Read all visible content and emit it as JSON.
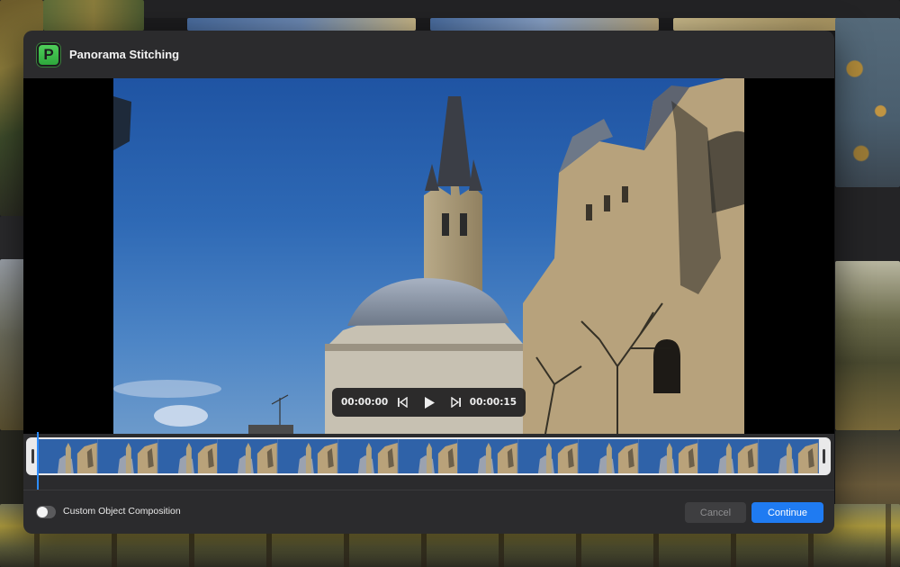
{
  "dialog": {
    "title": "Panorama Stitching",
    "app_icon_letter": "P",
    "accent_color": "#1f7bf2",
    "icon_color": "#3fbf4c"
  },
  "player": {
    "current_time": "00:00:00",
    "total_time": "00:00:15",
    "icons": [
      "skip-back-icon",
      "play-icon",
      "skip-forward-icon"
    ]
  },
  "filmstrip": {
    "frame_count": 13,
    "playhead_position": 0
  },
  "footer": {
    "toggle_label": "Custom Object Composition",
    "toggle_on": false,
    "cancel_label": "Cancel",
    "continue_label": "Continue"
  }
}
